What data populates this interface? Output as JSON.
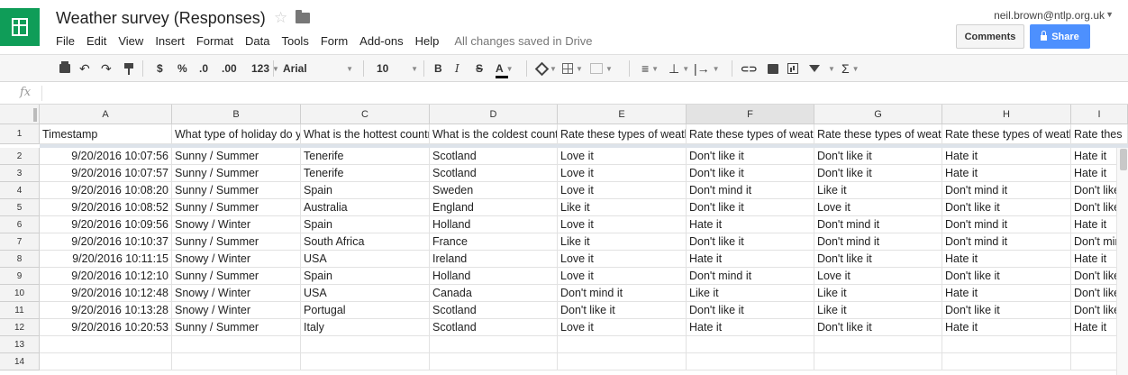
{
  "app": {
    "title": "Weather survey (Responses)",
    "account": "neil.brown@ntlp.org.uk",
    "save_status": "All changes saved in Drive",
    "comments_label": "Comments",
    "share_label": "Share",
    "icons": [
      "sheets-logo-icon",
      "star-icon",
      "folder-icon",
      "lock-icon"
    ]
  },
  "menu": [
    "File",
    "Edit",
    "View",
    "Insert",
    "Format",
    "Data",
    "Tools",
    "Form",
    "Add-ons",
    "Help"
  ],
  "toolbar": {
    "currency": "$",
    "percent": "%",
    "dec_decrease": ".0",
    "dec_increase": ".00",
    "more_formats": "123",
    "font": "Arial",
    "font_size": "10",
    "bold": "B",
    "italic": "I",
    "strike": "S",
    "text_color": "A",
    "link": "⊂⊃",
    "sum": "Σ"
  },
  "formula_bar": {
    "label": "fx",
    "value": ""
  },
  "columns": [
    "A",
    "B",
    "C",
    "D",
    "E",
    "F",
    "G",
    "H",
    "I"
  ],
  "selected_column": "F",
  "headers": [
    "Timestamp",
    "What type of holiday do y",
    "What is the hottest countr",
    "What is the coldest count",
    "Rate these types of weatl",
    "Rate these types of weatl",
    "Rate these types of weatl",
    "Rate these types of weatl",
    "Rate thes"
  ],
  "rows": [
    [
      "9/20/2016 10:07:56",
      "Sunny / Summer",
      "Tenerife",
      "Scotland",
      "Love it",
      "Don't like it",
      "Don't like it",
      "Hate it",
      "Hate it"
    ],
    [
      "9/20/2016 10:07:57",
      "Sunny / Summer",
      "Tenerife",
      "Scotland",
      "Love it",
      "Don't like it",
      "Don't like it",
      "Hate it",
      "Hate it"
    ],
    [
      "9/20/2016 10:08:20",
      "Sunny / Summer",
      "Spain",
      "Sweden",
      "Love it",
      "Don't mind it",
      "Like it",
      "Don't mind it",
      "Don't like"
    ],
    [
      "9/20/2016 10:08:52",
      "Sunny / Summer",
      "Australia",
      "England",
      "Like it",
      "Don't like it",
      "Love it",
      "Don't like it",
      "Don't like"
    ],
    [
      "9/20/2016 10:09:56",
      "Snowy / Winter",
      "Spain",
      "Holland",
      "Love it",
      "Hate it",
      "Don't mind it",
      "Don't mind it",
      "Hate it"
    ],
    [
      "9/20/2016 10:10:37",
      "Sunny / Summer",
      "South Africa",
      "France",
      "Like it",
      "Don't like it",
      "Don't mind it",
      "Don't mind it",
      "Don't mir"
    ],
    [
      "9/20/2016 10:11:15",
      "Snowy / Winter",
      "USA",
      "Ireland",
      "Love it",
      "Hate it",
      "Don't like it",
      "Hate it",
      "Hate it"
    ],
    [
      "9/20/2016 10:12:10",
      "Sunny / Summer",
      "Spain",
      "Holland",
      "Love it",
      "Don't mind it",
      "Love it",
      "Don't like it",
      "Don't like"
    ],
    [
      "9/20/2016 10:12:48",
      "Snowy / Winter",
      "USA",
      "Canada",
      "Don't mind it",
      "Like it",
      "Like it",
      "Hate it",
      "Don't like"
    ],
    [
      "9/20/2016 10:13:28",
      "Snowy / Winter",
      "Portugal",
      "Scotland",
      "Don't like it",
      "Don't like it",
      "Like it",
      "Don't like it",
      "Don't like"
    ],
    [
      "9/20/2016 10:20:53",
      "Sunny / Summer",
      "Italy",
      "Scotland",
      "Love it",
      "Hate it",
      "Don't like it",
      "Hate it",
      "Hate it"
    ],
    [
      "",
      "",
      "",
      "",
      "",
      "",
      "",
      "",
      ""
    ],
    [
      "",
      "",
      "",
      "",
      "",
      "",
      "",
      "",
      ""
    ]
  ],
  "row_numbers": [
    "1",
    "2",
    "3",
    "4",
    "5",
    "6",
    "7",
    "8",
    "9",
    "10",
    "11",
    "12",
    "13",
    "14"
  ],
  "colors": {
    "logo": "#0f9d58",
    "share": "#4d90fe",
    "frozen": "#dde3ea"
  }
}
